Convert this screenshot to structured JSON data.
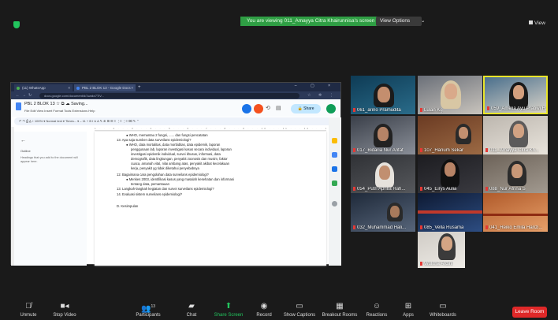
{
  "banner": {
    "viewing_text": "You are viewing 011_Amayya Citra Khairunnisa's screen",
    "view_options_label": "View Options",
    "view_options_caret": "⌄",
    "view_label": "View"
  },
  "shared": {
    "tabs": [
      {
        "label": "(11) WhatsApp",
        "close": "×"
      },
      {
        "label": "PBL 2 BLOK 13 - Google Docs",
        "close": "×"
      }
    ],
    "newtab": "+",
    "window_controls": "–  ▢  ×",
    "url": "docs.google.com/document/d/1wakx7TlV...",
    "doc_title": "PBL 2 BLOK 13  ☆  ⧉  ☁  Saving...",
    "doc_menu": "File  Edit  View  Insert  Format  Tools  Extensions  Help",
    "share_label": "Share",
    "toolbar_text": "↶  ↷  ⎙  A̲  ↕  100%  ▾  Normal text  ▾  Times...  ▾  –  11  +  B  I  U  A  ✎  ⊕  ⊞  ☰  ≡  ⋮≡  ⋮≡  ⌧  ✎  ⌃",
    "ruler_text": "1 . . . 2 . . . 3 . . . 4 . . . 5 . . . 6 . . . 7 . . . 8 . . . 9 . . . 10 . . . 11 . . . 12 . . . 13 . . . 14 . . . 15",
    "outline_back": "←",
    "outline_label": "Outline",
    "outline_hint": "Headings that you add to the document will appear here.",
    "paragraphs": [
      "●  WHO, memantau 2 fungsi, ...... dan fungsi pencatatan",
      "13. Apa saja sumber data surveilans epidemiologi?",
      "●  WHO, data mortalitas, data morbiditas, data epidemik, laporan",
      "penggunaan lab, laporan investigasi kasus secara individual, laporan",
      "investigasi epidemik individual, survei khusus, informasi, data",
      "demografik, data lingkungan, penyakit zoonosis dan musim, faktor",
      "cuaca, amanah vital, nilai ambang atas, penyakit akibat kecelakaan",
      "kerja, penyakit yg tidak diketahui penyebabnya",
      "12. Bagaimana cara pengolahan data surveilans epidemiologi?",
      "●  Menkes 2003, identifikasi kasus yang masalah kesehatan dan informasi",
      "tentang data, pemantauan",
      "13. Langkah-langkah kegiatan dan survei surveilans epidemiologi?",
      "14. Evaluasi sistem surveilans epidemiologi?",
      "D.  Kesimpulan"
    ]
  },
  "gallery": [
    {
      "name": "061_arino Pramudita"
    },
    {
      "name": "Lulan Kg"
    },
    {
      "name": "059_Amelia Ayu Pratiwi H..."
    },
    {
      "name": "017_Bidaria Nur Arifat"
    },
    {
      "name": "107_Hanum Sekar"
    },
    {
      "name": "011_Amayya Citra Kh..."
    },
    {
      "name": "054_Putri Aprilla Rah..."
    },
    {
      "name": "045_Eirys Aulia"
    },
    {
      "name": "088_Nur Afrina S"
    },
    {
      "name": "032_Muhammad Hali..."
    },
    {
      "name": "085_Vella Rusama"
    },
    {
      "name": "041_Reiko Emila Harizi..."
    },
    {
      "name": "Wulitha Ardini"
    }
  ],
  "toolbar": {
    "unmute": "Unmute",
    "stop_video": "Stop Video",
    "participants": "Participants",
    "participants_count": "13",
    "chat": "Chat",
    "share_screen": "Share Screen",
    "record": "Record",
    "show_captions": "Show Captions",
    "breakout_rooms": "Breakout Rooms",
    "reactions": "Reactions",
    "apps": "Apps",
    "whiteboards": "Whiteboards",
    "leave_room": "Leave Room"
  },
  "colors": {
    "banner_green": "#2f9e44",
    "leave_red": "#e02828",
    "share_screen_green": "#22c55e",
    "active_speaker_yellow": "#e9e52a"
  }
}
